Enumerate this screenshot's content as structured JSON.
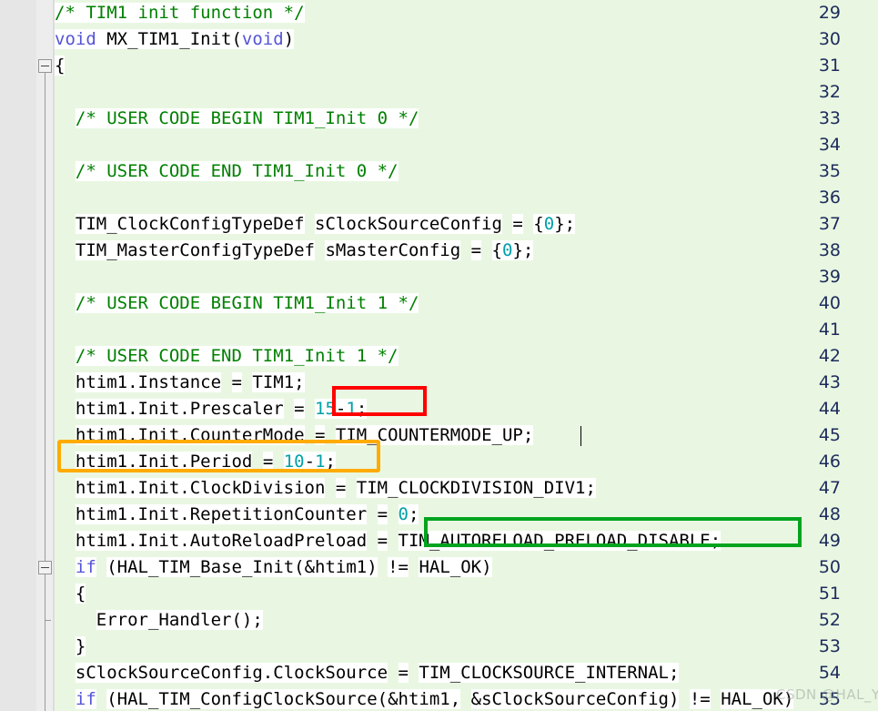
{
  "editor": {
    "first_line": 29,
    "colors": {
      "background": "#e9f7e2",
      "gutter": "#e6e6e6",
      "line_number": "#1d2b5c",
      "comment": "#008000",
      "keyword": "#5454d6",
      "number": "#00a0a8",
      "token_highlight": "#ffffff",
      "annotation_red": "#fe0000",
      "annotation_orange": "#ffab00",
      "annotation_green": "#00a41e"
    }
  },
  "lines": [
    {
      "n": "29",
      "text": "/* TIM1 init function */"
    },
    {
      "n": "30",
      "text": "void MX_TIM1_Init(void)"
    },
    {
      "n": "31",
      "text": "{"
    },
    {
      "n": "32",
      "text": ""
    },
    {
      "n": "33",
      "text": "  /* USER CODE BEGIN TIM1_Init 0 */"
    },
    {
      "n": "34",
      "text": ""
    },
    {
      "n": "35",
      "text": "  /* USER CODE END TIM1_Init 0 */"
    },
    {
      "n": "36",
      "text": ""
    },
    {
      "n": "37",
      "text": "  TIM_ClockConfigTypeDef sClockSourceConfig = {0};"
    },
    {
      "n": "38",
      "text": "  TIM_MasterConfigTypeDef sMasterConfig = {0};"
    },
    {
      "n": "39",
      "text": ""
    },
    {
      "n": "40",
      "text": "  /* USER CODE BEGIN TIM1_Init 1 */"
    },
    {
      "n": "41",
      "text": ""
    },
    {
      "n": "42",
      "text": "  /* USER CODE END TIM1_Init 1 */"
    },
    {
      "n": "43",
      "text": "  htim1.Instance = TIM1;"
    },
    {
      "n": "44",
      "text": "  htim1.Init.Prescaler = 15-1;"
    },
    {
      "n": "45",
      "text": "  htim1.Init.CounterMode = TIM_COUNTERMODE_UP;"
    },
    {
      "n": "46",
      "text": "  htim1.Init.Period = 10-1;"
    },
    {
      "n": "47",
      "text": "  htim1.Init.ClockDivision = TIM_CLOCKDIVISION_DIV1;"
    },
    {
      "n": "48",
      "text": "  htim1.Init.RepetitionCounter = 0;"
    },
    {
      "n": "49",
      "text": "  htim1.Init.AutoReloadPreload = TIM_AUTORELOAD_PRELOAD_DISABLE;"
    },
    {
      "n": "50",
      "text": "  if (HAL_TIM_Base_Init(&htim1) != HAL_OK)"
    },
    {
      "n": "51",
      "text": "  {"
    },
    {
      "n": "52",
      "text": "    Error_Handler();"
    },
    {
      "n": "53",
      "text": "  }"
    },
    {
      "n": "54",
      "text": "  sClockSourceConfig.ClockSource = TIM_CLOCKSOURCE_INTERNAL;"
    },
    {
      "n": "55",
      "text": "  if (HAL_TIM_ConfigClockSource(&htim1, &sClockSourceConfig) != HAL_OK)"
    }
  ],
  "annotations": [
    {
      "name": "prescaler-highlight",
      "color": "red",
      "target_line": "44",
      "target_text": "15-1;"
    },
    {
      "name": "period-highlight",
      "color": "orange",
      "target_line": "46",
      "target_text": "htim1.Init.Period = 10-1;"
    },
    {
      "name": "autoreload-highlight",
      "color": "green",
      "target_line": "49",
      "target_text": "TIM_AUTORELOAD_PRELOAD_DISABLE;"
    }
  ],
  "fold_markers": [
    {
      "line": "31",
      "state": "expanded"
    },
    {
      "line": "51",
      "state": "expanded"
    }
  ],
  "caret": {
    "line": "45",
    "after_text": "TIM_COUNTERMODE_UP;"
  },
  "watermark": {
    "text": "CSDN @HAL_Yipin"
  }
}
